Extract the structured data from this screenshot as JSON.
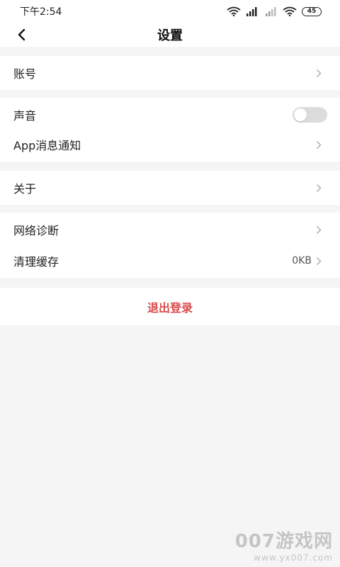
{
  "status_bar": {
    "time": "下午2:54",
    "battery": "45"
  },
  "nav": {
    "title": "设置"
  },
  "groups": {
    "account": {
      "label": "账号"
    },
    "sound": {
      "label": "声音",
      "enabled": false
    },
    "notifications": {
      "label": "App消息通知"
    },
    "about": {
      "label": "关于"
    },
    "network": {
      "label": "网络诊断"
    },
    "cache": {
      "label": "清理缓存",
      "value": "0KB"
    }
  },
  "logout": {
    "label": "退出登录",
    "color": "#d94b4b"
  },
  "watermark": {
    "brand": "007游戏网",
    "url": "www.yx007.com"
  }
}
